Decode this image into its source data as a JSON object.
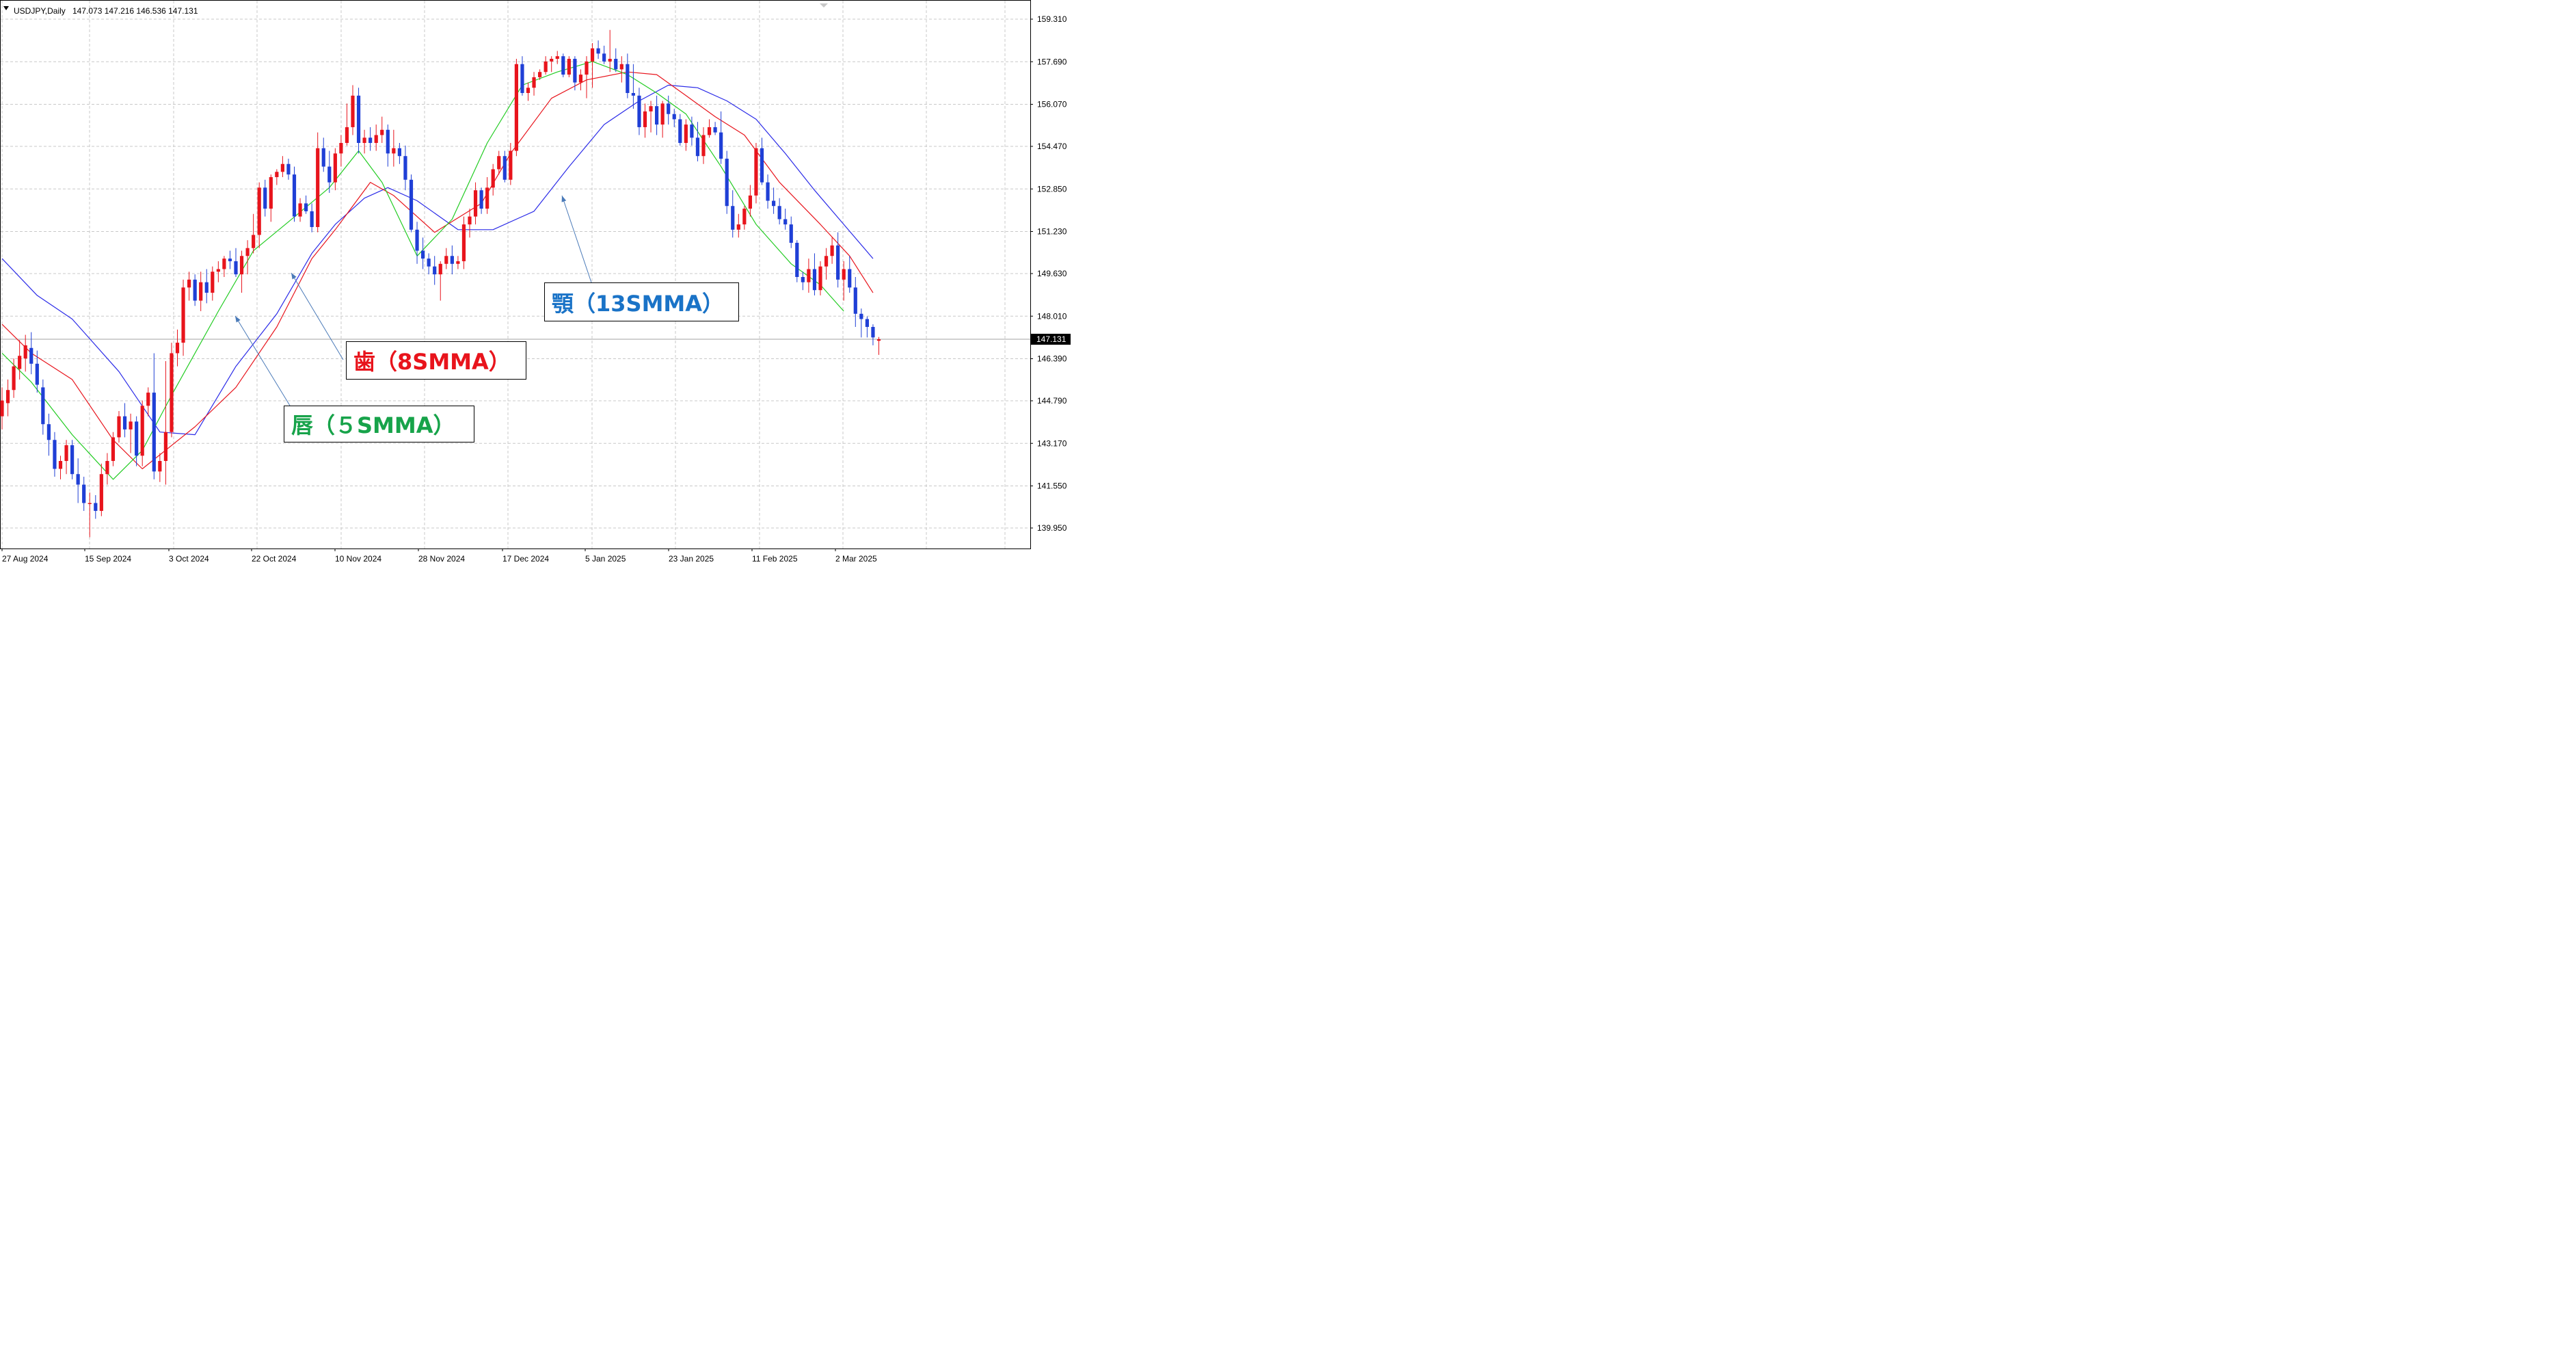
{
  "header": {
    "symbol": "USDJPY,Daily",
    "ohlc": "147.073 147.216 146.536 147.131"
  },
  "colors": {
    "bull": "#e8141c",
    "bear": "#1f3fd6",
    "jaw": "#2b2be8",
    "teeth": "#e8141c",
    "lips": "#22cc22",
    "grid": "#c8c8c8",
    "current_price_line": "#a0a0a0",
    "arrow": "#4a7ab8"
  },
  "labels": {
    "jaw": "顎（13SMMA）",
    "teeth": "歯（8SMMA）",
    "lips": "唇（５SMMA）"
  },
  "chart_data": {
    "type": "candlestick",
    "title": "USDJPY,Daily",
    "y_ticks": [
      "159.310",
      "157.690",
      "156.070",
      "154.470",
      "152.850",
      "151.230",
      "149.630",
      "148.010",
      "146.390",
      "144.790",
      "143.170",
      "141.550",
      "139.950"
    ],
    "x_ticks": [
      "27 Aug 2024",
      "15 Sep 2024",
      "3 Oct 2024",
      "22 Oct 2024",
      "10 Nov 2024",
      "28 Nov 2024",
      "17 Dec 2024",
      "5 Jan 2025",
      "23 Jan 2025",
      "11 Feb 2025",
      "2 Mar 2025"
    ],
    "ylim": [
      139.44,
      159.96
    ],
    "current_price": "147.131",
    "grid": true,
    "candles": [
      [
        144.2,
        145.3,
        143.7,
        144.8
      ],
      [
        144.7,
        145.6,
        144.2,
        145.2
      ],
      [
        145.2,
        146.4,
        144.9,
        146.1
      ],
      [
        146.0,
        147.1,
        145.6,
        146.5
      ],
      [
        146.4,
        147.3,
        145.9,
        146.9
      ],
      [
        146.8,
        147.4,
        145.8,
        146.2
      ],
      [
        146.2,
        146.7,
        145.1,
        145.4
      ],
      [
        145.3,
        145.6,
        143.5,
        143.9
      ],
      [
        143.9,
        144.3,
        142.7,
        143.3
      ],
      [
        143.3,
        143.6,
        141.9,
        142.2
      ],
      [
        142.2,
        142.7,
        141.8,
        142.5
      ],
      [
        142.5,
        143.3,
        142.0,
        143.1
      ],
      [
        143.1,
        143.3,
        141.8,
        142.0
      ],
      [
        142.0,
        142.6,
        140.9,
        141.6
      ],
      [
        141.6,
        141.9,
        140.6,
        140.9
      ],
      [
        140.9,
        141.3,
        139.6,
        140.9
      ],
      [
        140.9,
        141.2,
        140.3,
        140.6
      ],
      [
        140.6,
        142.4,
        140.4,
        142.0
      ],
      [
        142.0,
        142.8,
        141.6,
        142.5
      ],
      [
        142.5,
        143.6,
        142.3,
        143.4
      ],
      [
        143.4,
        144.4,
        143.2,
        144.2
      ],
      [
        144.2,
        144.7,
        143.4,
        143.7
      ],
      [
        143.7,
        144.3,
        142.8,
        144.0
      ],
      [
        144.0,
        144.2,
        142.3,
        142.7
      ],
      [
        142.7,
        144.8,
        142.3,
        144.6
      ],
      [
        144.6,
        145.3,
        144.2,
        145.1
      ],
      [
        145.1,
        146.6,
        141.8,
        142.1
      ],
      [
        142.1,
        142.8,
        141.7,
        142.5
      ],
      [
        142.5,
        146.3,
        141.6,
        143.6
      ],
      [
        143.6,
        147.0,
        143.4,
        146.6
      ],
      [
        146.6,
        147.5,
        146.1,
        147.0
      ],
      [
        147.0,
        149.4,
        146.5,
        149.1
      ],
      [
        149.1,
        149.7,
        148.6,
        149.4
      ],
      [
        149.4,
        149.6,
        148.4,
        148.6
      ],
      [
        148.6,
        149.7,
        148.2,
        149.3
      ],
      [
        149.3,
        149.8,
        148.5,
        148.9
      ],
      [
        148.9,
        149.9,
        148.6,
        149.7
      ],
      [
        149.7,
        150.1,
        149.3,
        149.8
      ],
      [
        149.8,
        150.3,
        149.5,
        150.2
      ],
      [
        150.2,
        150.5,
        149.8,
        150.1
      ],
      [
        150.1,
        150.6,
        149.5,
        149.6
      ],
      [
        149.6,
        150.5,
        148.9,
        150.3
      ],
      [
        150.3,
        150.9,
        149.6,
        150.6
      ],
      [
        150.6,
        151.9,
        150.4,
        151.1
      ],
      [
        151.1,
        153.1,
        150.6,
        152.9
      ],
      [
        152.9,
        153.2,
        151.8,
        152.1
      ],
      [
        152.1,
        153.4,
        151.6,
        153.3
      ],
      [
        153.3,
        153.6,
        153.0,
        153.5
      ],
      [
        153.5,
        154.1,
        153.3,
        153.8
      ],
      [
        153.8,
        154.0,
        153.2,
        153.4
      ],
      [
        153.4,
        153.7,
        151.6,
        151.8
      ],
      [
        151.8,
        152.5,
        151.6,
        152.3
      ],
      [
        152.3,
        152.6,
        151.9,
        152.0
      ],
      [
        152.0,
        152.3,
        151.2,
        151.4
      ],
      [
        151.4,
        155.0,
        151.2,
        154.4
      ],
      [
        154.4,
        154.8,
        153.5,
        153.7
      ],
      [
        153.7,
        154.3,
        152.7,
        153.1
      ],
      [
        153.1,
        154.4,
        152.8,
        154.2
      ],
      [
        154.2,
        154.9,
        153.7,
        154.6
      ],
      [
        154.6,
        156.1,
        154.5,
        155.2
      ],
      [
        155.2,
        156.8,
        154.9,
        156.4
      ],
      [
        156.4,
        156.7,
        154.2,
        154.6
      ],
      [
        154.6,
        155.1,
        154.2,
        154.8
      ],
      [
        154.8,
        155.2,
        154.3,
        154.6
      ],
      [
        154.6,
        155.3,
        154.3,
        154.9
      ],
      [
        154.9,
        155.6,
        154.6,
        155.1
      ],
      [
        155.1,
        155.3,
        153.7,
        154.2
      ],
      [
        154.2,
        155.1,
        153.7,
        154.4
      ],
      [
        154.4,
        154.6,
        153.8,
        154.1
      ],
      [
        154.1,
        154.5,
        152.8,
        153.2
      ],
      [
        153.2,
        153.4,
        151.2,
        151.3
      ],
      [
        151.3,
        151.6,
        150.0,
        150.5
      ],
      [
        150.5,
        151.0,
        149.8,
        150.2
      ],
      [
        150.2,
        150.4,
        149.6,
        149.9
      ],
      [
        149.9,
        150.3,
        149.2,
        149.6
      ],
      [
        149.6,
        150.1,
        148.6,
        150.0
      ],
      [
        150.0,
        150.6,
        149.8,
        150.3
      ],
      [
        150.3,
        150.7,
        149.6,
        150.0
      ],
      [
        150.0,
        150.3,
        149.8,
        150.1
      ],
      [
        150.1,
        151.8,
        149.8,
        151.5
      ],
      [
        151.5,
        152.1,
        151.0,
        151.8
      ],
      [
        151.8,
        153.1,
        151.5,
        152.8
      ],
      [
        152.8,
        152.9,
        151.9,
        152.1
      ],
      [
        152.1,
        153.3,
        151.9,
        152.9
      ],
      [
        152.9,
        153.8,
        152.6,
        153.6
      ],
      [
        153.6,
        154.3,
        153.4,
        154.1
      ],
      [
        154.1,
        154.3,
        153.1,
        153.2
      ],
      [
        153.2,
        154.6,
        153.0,
        154.3
      ],
      [
        154.3,
        157.8,
        154.1,
        157.6
      ],
      [
        157.6,
        157.9,
        156.4,
        156.5
      ],
      [
        156.5,
        156.9,
        156.2,
        156.7
      ],
      [
        156.7,
        157.3,
        156.4,
        157.1
      ],
      [
        157.1,
        157.4,
        157.0,
        157.3
      ],
      [
        157.3,
        157.9,
        157.2,
        157.7
      ],
      [
        157.7,
        157.9,
        157.3,
        157.8
      ],
      [
        157.8,
        158.1,
        157.6,
        157.9
      ],
      [
        157.9,
        158.0,
        157.1,
        157.2
      ],
      [
        157.2,
        157.9,
        157.1,
        157.8
      ],
      [
        157.8,
        157.9,
        156.6,
        156.9
      ],
      [
        156.9,
        157.4,
        156.6,
        157.2
      ],
      [
        157.2,
        157.9,
        156.3,
        157.7
      ],
      [
        157.7,
        158.4,
        156.7,
        158.2
      ],
      [
        158.2,
        158.5,
        157.8,
        158.0
      ],
      [
        158.0,
        158.3,
        157.6,
        157.7
      ],
      [
        157.7,
        158.9,
        157.3,
        157.8
      ],
      [
        157.8,
        158.2,
        157.3,
        157.4
      ],
      [
        157.4,
        157.9,
        156.9,
        157.6
      ],
      [
        157.6,
        158.0,
        156.3,
        156.5
      ],
      [
        156.5,
        157.6,
        155.9,
        156.4
      ],
      [
        156.4,
        156.7,
        154.9,
        155.2
      ],
      [
        155.2,
        156.1,
        154.8,
        155.8
      ],
      [
        155.8,
        156.2,
        155.0,
        156.0
      ],
      [
        156.0,
        156.4,
        154.9,
        155.3
      ],
      [
        155.3,
        156.2,
        154.8,
        156.1
      ],
      [
        156.1,
        156.4,
        155.3,
        155.7
      ],
      [
        155.7,
        155.9,
        155.2,
        155.5
      ],
      [
        155.5,
        155.7,
        154.5,
        154.6
      ],
      [
        154.6,
        155.5,
        154.3,
        155.3
      ],
      [
        155.3,
        155.6,
        154.5,
        154.8
      ],
      [
        154.8,
        155.4,
        153.9,
        154.1
      ],
      [
        154.1,
        155.2,
        153.8,
        154.9
      ],
      [
        154.9,
        155.5,
        154.8,
        155.2
      ],
      [
        155.2,
        155.4,
        154.9,
        155.0
      ],
      [
        155.0,
        155.8,
        153.8,
        154.0
      ],
      [
        154.0,
        154.3,
        151.9,
        152.2
      ],
      [
        152.2,
        152.8,
        151.0,
        151.3
      ],
      [
        151.3,
        151.9,
        151.0,
        151.5
      ],
      [
        151.5,
        152.2,
        151.3,
        152.1
      ],
      [
        152.1,
        153.0,
        151.8,
        152.6
      ],
      [
        152.6,
        154.6,
        152.3,
        154.4
      ],
      [
        154.4,
        154.8,
        153.0,
        153.1
      ],
      [
        153.1,
        153.4,
        152.1,
        152.4
      ],
      [
        152.4,
        152.9,
        151.9,
        152.2
      ],
      [
        152.2,
        152.5,
        151.5,
        151.7
      ],
      [
        151.7,
        152.1,
        151.3,
        151.5
      ],
      [
        151.5,
        151.8,
        150.6,
        150.8
      ],
      [
        150.8,
        150.9,
        149.3,
        149.5
      ],
      [
        149.5,
        149.7,
        149.0,
        149.3
      ],
      [
        149.3,
        150.2,
        148.9,
        149.8
      ],
      [
        149.8,
        150.4,
        148.8,
        149.0
      ],
      [
        149.0,
        150.1,
        148.8,
        149.9
      ],
      [
        149.9,
        150.6,
        149.4,
        150.3
      ],
      [
        150.3,
        151.0,
        150.0,
        150.7
      ],
      [
        150.7,
        151.2,
        149.1,
        149.4
      ],
      [
        149.4,
        150.1,
        148.6,
        149.8
      ],
      [
        149.8,
        150.3,
        148.9,
        149.1
      ],
      [
        149.1,
        149.5,
        147.6,
        148.1
      ],
      [
        148.1,
        148.3,
        147.2,
        147.9
      ],
      [
        147.9,
        148.0,
        147.2,
        147.6
      ],
      [
        147.6,
        147.7,
        146.9,
        147.2
      ],
      [
        147.073,
        147.216,
        146.536,
        147.131
      ]
    ],
    "series": [
      {
        "name": "顎（13SMMA）",
        "values": [
          [
            0,
            150.2
          ],
          [
            6,
            148.8
          ],
          [
            12,
            147.9
          ],
          [
            20,
            145.9
          ],
          [
            27,
            143.6
          ],
          [
            33,
            143.5
          ],
          [
            40,
            146.1
          ],
          [
            47,
            148.1
          ],
          [
            53,
            150.4
          ],
          [
            57,
            151.5
          ],
          [
            62,
            152.5
          ],
          [
            66,
            152.9
          ],
          [
            71,
            152.4
          ],
          [
            78,
            151.3
          ],
          [
            84,
            151.3
          ],
          [
            91,
            152.0
          ],
          [
            97,
            153.7
          ],
          [
            103,
            155.3
          ],
          [
            109,
            156.2
          ],
          [
            114,
            156.8
          ],
          [
            119,
            156.7
          ],
          [
            124,
            156.2
          ],
          [
            129,
            155.5
          ],
          [
            134,
            154.2
          ],
          [
            139,
            152.8
          ],
          [
            144,
            151.5
          ],
          [
            149,
            150.2
          ]
        ]
      },
      {
        "name": "歯（8SMMA）",
        "values": [
          [
            0,
            147.7
          ],
          [
            5,
            146.6
          ],
          [
            12,
            145.6
          ],
          [
            19,
            143.3
          ],
          [
            24,
            142.2
          ],
          [
            33,
            143.8
          ],
          [
            40,
            145.3
          ],
          [
            47,
            147.6
          ],
          [
            53,
            150.2
          ],
          [
            57,
            151.3
          ],
          [
            63,
            153.1
          ],
          [
            67,
            152.6
          ],
          [
            74,
            151.2
          ],
          [
            82,
            152.3
          ],
          [
            87,
            154.2
          ],
          [
            94,
            156.3
          ],
          [
            100,
            157.0
          ],
          [
            107,
            157.3
          ],
          [
            112,
            157.2
          ],
          [
            117,
            156.4
          ],
          [
            122,
            155.6
          ],
          [
            127,
            154.9
          ],
          [
            133,
            153.1
          ],
          [
            140,
            151.5
          ],
          [
            145,
            150.3
          ],
          [
            149,
            148.9
          ]
        ]
      },
      {
        "name": "唇（５SMMA）",
        "values": [
          [
            0,
            146.6
          ],
          [
            5,
            145.5
          ],
          [
            12,
            143.5
          ],
          [
            19,
            141.8
          ],
          [
            24,
            142.9
          ],
          [
            29,
            145.0
          ],
          [
            37,
            148.2
          ],
          [
            43,
            150.5
          ],
          [
            49,
            151.6
          ],
          [
            56,
            152.9
          ],
          [
            61,
            154.3
          ],
          [
            65,
            153.1
          ],
          [
            71,
            150.3
          ],
          [
            77,
            151.7
          ],
          [
            83,
            154.6
          ],
          [
            89,
            156.8
          ],
          [
            95,
            157.3
          ],
          [
            101,
            157.7
          ],
          [
            107,
            157.2
          ],
          [
            112,
            156.5
          ],
          [
            117,
            155.7
          ],
          [
            123,
            153.7
          ],
          [
            129,
            151.5
          ],
          [
            135,
            150.0
          ],
          [
            140,
            149.2
          ],
          [
            144,
            148.2
          ]
        ]
      }
    ]
  }
}
